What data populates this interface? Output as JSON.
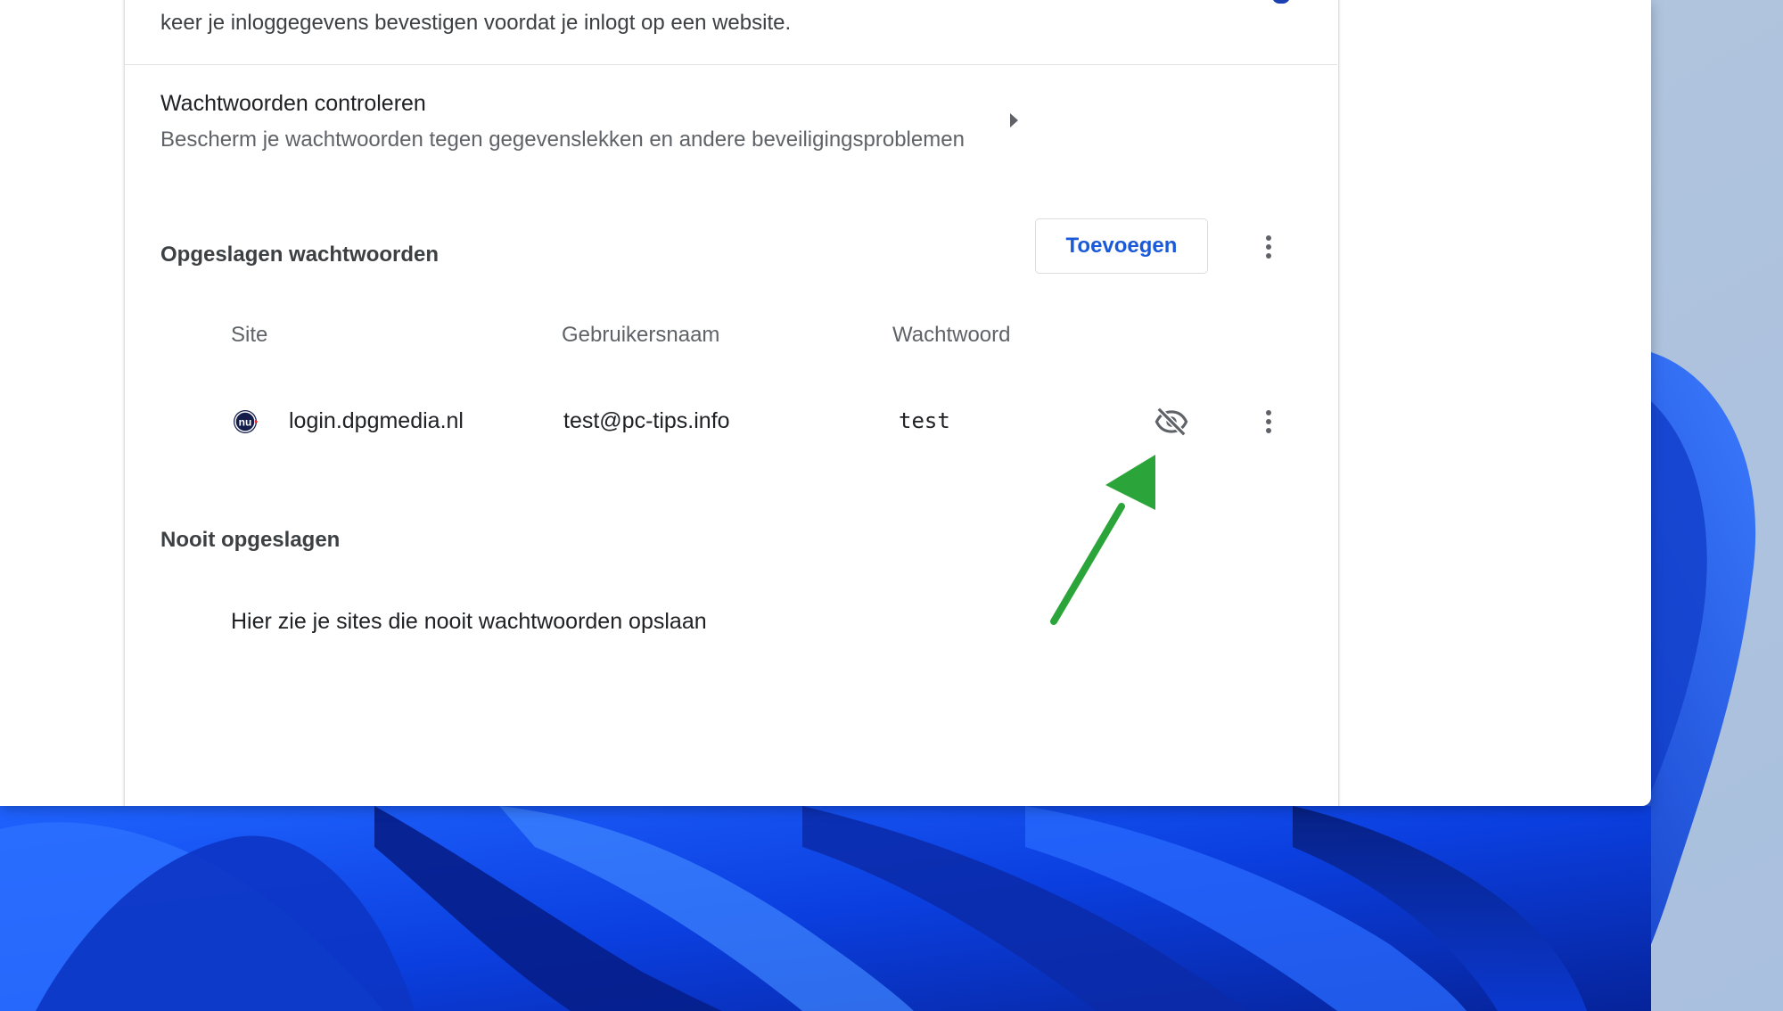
{
  "intro": {
    "text": "keer je inloggegevens bevestigen voordat je inlogt op een website."
  },
  "password_check": {
    "title": "Wachtwoorden controleren",
    "subtitle": "Bescherm je wachtwoorden tegen gegevenslekken en andere beveiligingsproblemen",
    "arrow_icon": "arrow-right-icon"
  },
  "saved_passwords": {
    "title": "Opgeslagen wachtwoorden",
    "add_button_label": "Toevoegen",
    "more_icon": "more-vert-icon",
    "columns": {
      "site": "Site",
      "username": "Gebruikersnaam",
      "password": "Wachtwoord"
    },
    "rows": [
      {
        "favicon_icon": "nu-site-favicon",
        "site": "login.dpgmedia.nl",
        "username": "test@pc-tips.info",
        "password": "test",
        "visibility_icon": "eye-off-icon",
        "more_icon": "more-vert-icon"
      }
    ]
  },
  "never_saved": {
    "title": "Nooit opgeslagen",
    "empty_text": "Hier zie je sites die nooit wachtwoorden opslaan"
  },
  "colors": {
    "accent_blue": "#1a5ad8",
    "annotation_arrow": "#2ba53a",
    "wallpaper_blue": "#0a3cd6"
  }
}
